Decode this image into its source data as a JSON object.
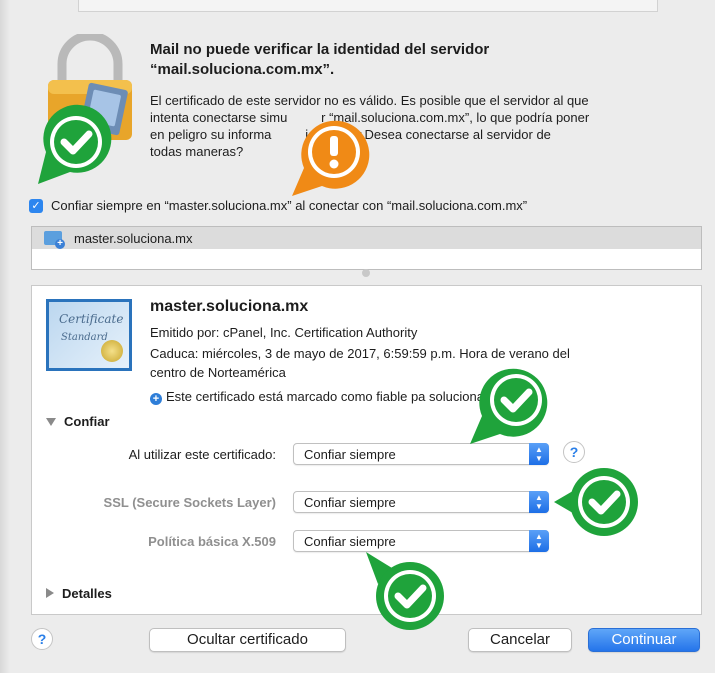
{
  "dialog": {
    "title_line1": "Mail no puede verificar la identidad del servidor",
    "title_line2": "“mail.soluciona.com.mx”.",
    "message_lines": [
      "El certificado de este servidor no es válido. Es posible que el servidor al que",
      "intenta conectarse simu             r “mail.soluciona.com.mx”, lo que podría poner",
      "en peligro su informa             idencial. ¿Desea conectarse al servidor de",
      "todas maneras?"
    ],
    "always_trust_label": "Confiar siempre en “master.soluciona.mx” al conectar con “mail.soluciona.com.mx”",
    "always_trust_checked": true
  },
  "cert_list": {
    "items": [
      {
        "label": "master.soluciona.mx",
        "selected": true
      }
    ]
  },
  "cert_image": {
    "line1": "Certificate",
    "line2": "Standard"
  },
  "cert_detail": {
    "name": "master.soluciona.mx",
    "issued_by": "Emitido por: cPanel, Inc. Certification Authority",
    "expires_line1": "Caduca: miércoles, 3 de mayo de 2017, 6:59:59 p.m. Hora de verano del",
    "expires_line2": "centro de Norteamérica",
    "trusted_note": "Este certificado está marcado como fiable pa                          soluciona.com.mx”"
  },
  "trust_section": {
    "heading": "Confiar",
    "expanded": true,
    "rows": [
      {
        "label": "Al utilizar este certificado:",
        "value": "Confiar siempre",
        "dim": false
      },
      {
        "label": "SSL (Secure Sockets Layer)",
        "value": "Confiar siempre",
        "dim": true
      },
      {
        "label": "Política básica X.509",
        "value": "Confiar siempre",
        "dim": true
      }
    ],
    "help_label": "?"
  },
  "details_section": {
    "heading": "Detalles",
    "expanded": false
  },
  "buttons": {
    "help": "?",
    "hide_certificate": "Ocultar certificado",
    "cancel": "Cancelar",
    "continue": "Continuar"
  },
  "colors": {
    "accent": "#2d86ef",
    "badge_green": "#1fa33b",
    "badge_orange": "#f08a16"
  },
  "icons": {
    "lock": "lock-icon",
    "certificate": "certificate-icon",
    "check_badge": "green-check-badge-icon",
    "warning_badge": "orange-exclamation-badge-icon"
  }
}
